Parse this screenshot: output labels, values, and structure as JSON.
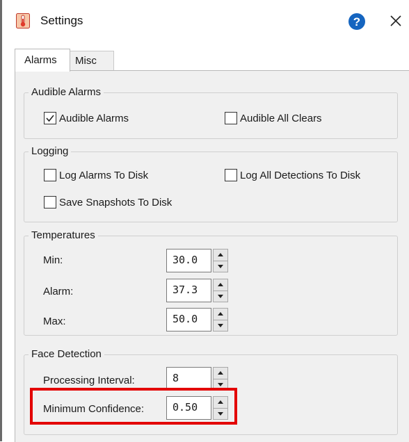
{
  "window": {
    "title": "Settings",
    "app_icon": "thermometer-icon",
    "help_icon": "help-icon",
    "close_icon": "close-icon",
    "help_color": "#1565c0"
  },
  "tabs": [
    {
      "label": "Alarms",
      "selected": true
    },
    {
      "label": "Misc",
      "selected": false
    }
  ],
  "audible_alarms": {
    "title": "Audible Alarms",
    "items": [
      {
        "label": "Audible Alarms",
        "checked": true
      },
      {
        "label": "Audible All Clears",
        "checked": false
      }
    ]
  },
  "logging": {
    "title": "Logging",
    "items": [
      {
        "label": "Log Alarms To Disk",
        "checked": false
      },
      {
        "label": "Log All Detections To Disk",
        "checked": false
      },
      {
        "label": "Save Snapshots To Disk",
        "checked": false
      }
    ]
  },
  "temperatures": {
    "title": "Temperatures",
    "fields": [
      {
        "label": "Min:",
        "value": "30.0"
      },
      {
        "label": "Alarm:",
        "value": "37.3"
      },
      {
        "label": "Max:",
        "value": "50.0"
      }
    ]
  },
  "face_detection": {
    "title": "Face Detection",
    "fields": [
      {
        "label": "Processing Interval:",
        "value": "8"
      },
      {
        "label": "Minimum Confidence:",
        "value": "0.50",
        "highlighted": true
      }
    ]
  },
  "highlight_color": "#e30000"
}
